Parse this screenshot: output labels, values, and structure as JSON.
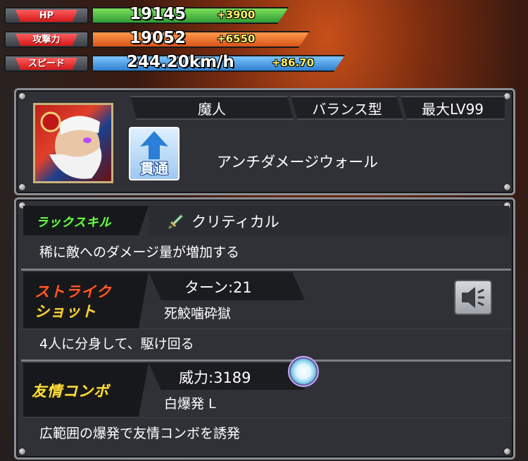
{
  "stats": [
    {
      "label": "HP",
      "value": "19145",
      "bonus": "+3900",
      "color": "green"
    },
    {
      "label": "攻撃力",
      "value": "19052",
      "bonus": "+6550",
      "color": "orange"
    },
    {
      "label": "スピード",
      "value": "244.20km/h",
      "bonus": "+86.70",
      "color": "blue"
    }
  ],
  "monster": {
    "race": "魔人",
    "type": "バランス型",
    "max_level": "最大LV99",
    "ability": "アンチダメージウォール",
    "attack_badge": "貫通"
  },
  "luck_skill": {
    "header": "ラックスキル",
    "name": "クリティカル",
    "description": "稀に敵へのダメージ量が増加する"
  },
  "strike_shot": {
    "header_line1": "ストライク",
    "header_line2": "ショット",
    "turns": "ターン:21",
    "name": "死鮫噛砕獄",
    "description": "4人に分身して、駆け回る"
  },
  "friendship_combo": {
    "header": "友情コンボ",
    "power": "威力:3189",
    "name": "白爆発 L",
    "description": "広範囲の爆発で友情コンボを誘発"
  },
  "colors": {
    "hp_bar": "#3fb84a",
    "atk_bar": "#e8611f",
    "spd_bar": "#3a8fd6",
    "accent_yellow": "#fff26a"
  }
}
